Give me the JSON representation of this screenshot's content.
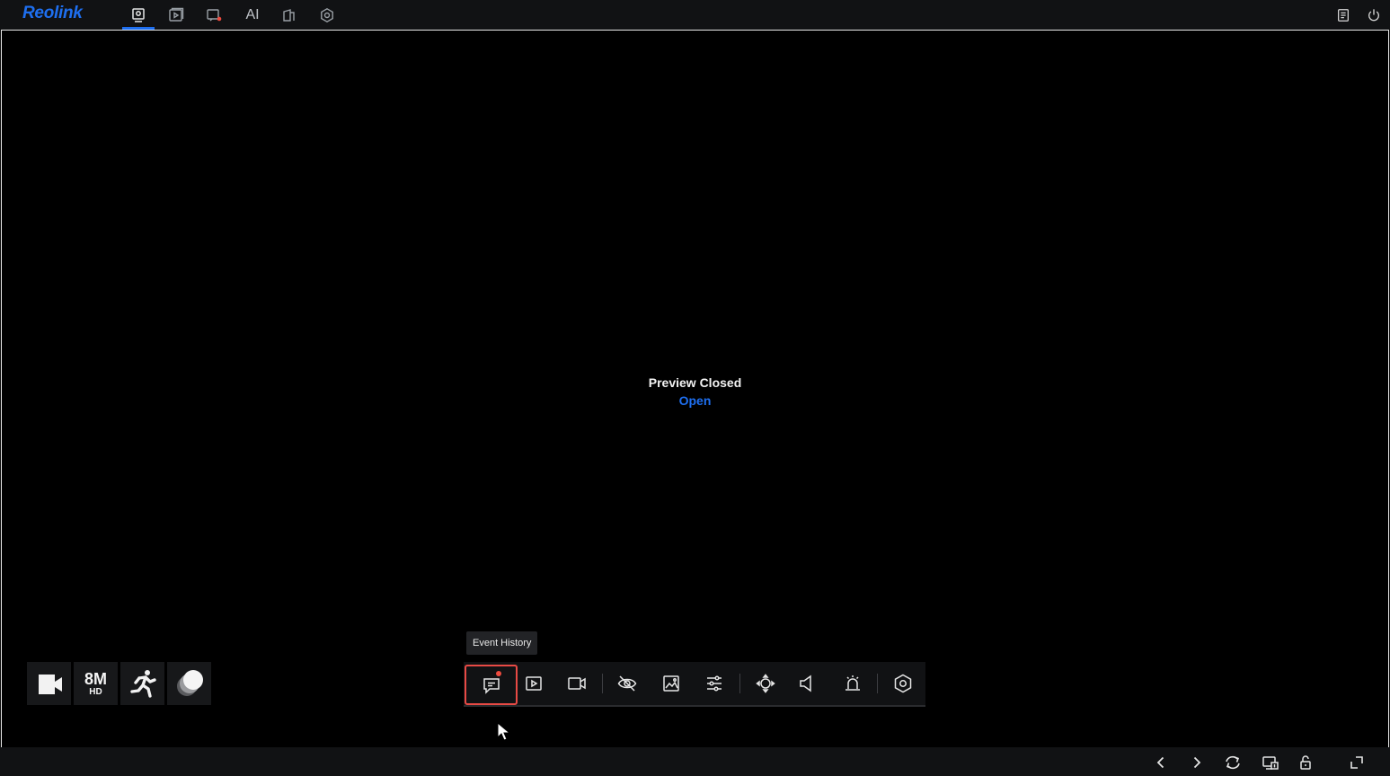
{
  "app": {
    "logo": "Reolink",
    "accent": "#1e6ff0"
  },
  "nav": {
    "tabs": [
      {
        "icon": "live-view-icon",
        "active": true
      },
      {
        "icon": "playback-icon"
      },
      {
        "icon": "alerts-icon",
        "badge": true
      },
      {
        "label": "AI"
      },
      {
        "icon": "device-icon"
      },
      {
        "icon": "settings-icon"
      }
    ],
    "right": [
      {
        "icon": "notes-icon"
      },
      {
        "icon": "power-icon"
      }
    ]
  },
  "preview": {
    "title": "Preview Closed",
    "open_label": "Open"
  },
  "status": {
    "resolution": "8M",
    "resolution_sub": "HD",
    "icons": [
      "camera-icon",
      "resolution-badge",
      "motion-icon",
      "day-night-icon"
    ]
  },
  "tooltip": {
    "text": "Event History"
  },
  "toolbar": {
    "items": [
      "event-history-icon",
      "playback-icon",
      "record-icon",
      "privacy-mask-icon",
      "image-icon",
      "adjust-icon",
      "ptz-icon",
      "audio-icon",
      "siren-icon",
      "camera-settings-icon"
    ],
    "highlight_color": "#e84a45"
  },
  "bottombar": {
    "items": [
      "previous-icon",
      "next-icon",
      "rotate-icon",
      "screen-layout-icon",
      "lock-icon",
      "fullscreen-icon"
    ]
  }
}
